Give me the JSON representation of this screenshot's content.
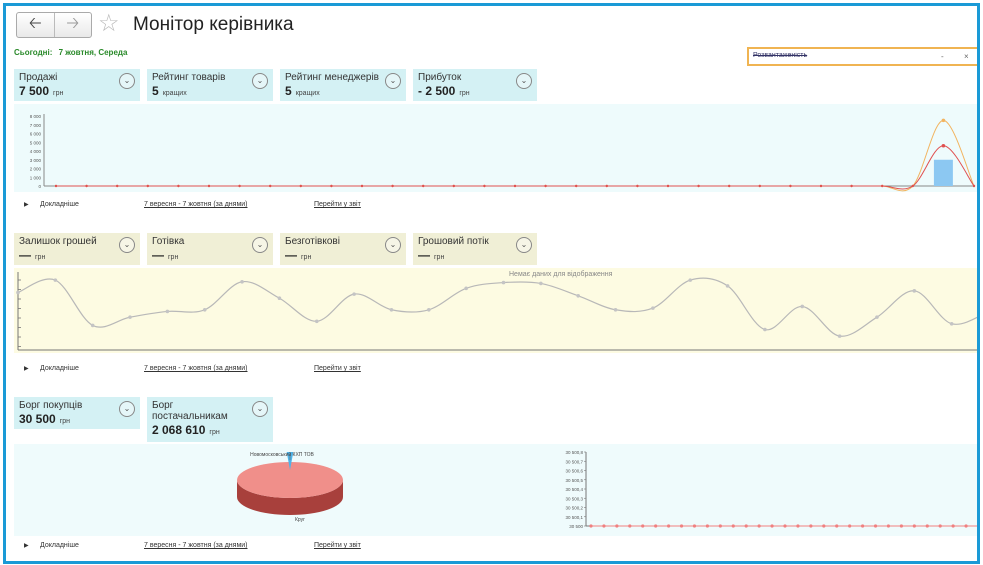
{
  "header": {
    "back_icon": "arrow-left-icon",
    "forward_icon": "arrow-right-icon",
    "favorite_icon": "star-icon",
    "title": "Монітор керівника",
    "today_label": "Сьогодні:",
    "today_date": "7 жовтня, Середа"
  },
  "search": {
    "value": "Розвантаженість",
    "minus_label": "-",
    "close_label": "×"
  },
  "sections": {
    "sales": {
      "cards": [
        {
          "label": "Продажі",
          "value": "7 500",
          "unit": "грн"
        },
        {
          "label": "Рейтинг товарів",
          "value": "5",
          "unit": "кращих"
        },
        {
          "label": "Рейтинг менеджерів",
          "value": "5",
          "unit": "кращих"
        },
        {
          "label": "Прибуток",
          "value": "- 2 500",
          "unit": "грн"
        }
      ],
      "footer": {
        "more": "Докладніше",
        "period": "7 вересня - 7 жовтня (за днями)",
        "goto": "Перейти у звіт"
      }
    },
    "money": {
      "cards": [
        {
          "label": "Залишок грошей",
          "value": "—",
          "unit": "грн"
        },
        {
          "label": "Готівка",
          "value": "—",
          "unit": "грн"
        },
        {
          "label": "Безготівкові",
          "value": "—",
          "unit": "грн"
        },
        {
          "label": "Грошовий потік",
          "value": "—",
          "unit": "грн"
        }
      ],
      "no_data": "Немає даних для відображення",
      "footer": {
        "more": "Докладніше",
        "period": "7 вересня - 7 жовтня (за днями)",
        "goto": "Перейти у звіт"
      }
    },
    "debts": {
      "cards": [
        {
          "label": "Борг покупців",
          "value": "30 500",
          "unit": "грн"
        },
        {
          "label": "Борг постачальникам",
          "value": "2 068 610",
          "unit": "грн"
        }
      ],
      "pie_label_top": "Новомосковський КХП ТОВ",
      "pie_label_bottom": "Круг",
      "footer": {
        "more": "Докладніше",
        "period": "7 вересня - 7 жовтня (за днями)",
        "goto": "Перейти у звіт"
      }
    }
  },
  "colors": {
    "accent": "#1a9ad6",
    "today_green": "#2a8a2a",
    "cyan_card": "#d4f1f4",
    "yellow_card": "#f0efd6",
    "pie_top": "#f08f8a",
    "pie_side": "#a8403c"
  },
  "chart_data": [
    {
      "type": "line",
      "title": "",
      "ylim": [
        0,
        8000
      ],
      "y_ticks": [
        "8 000",
        "7 000",
        "6 000",
        "5 000",
        "4 000",
        "3 000",
        "2 000",
        "1 000",
        "0"
      ],
      "points_count": 31,
      "peak_index": 29,
      "series": [
        {
          "name": "",
          "type": "bar",
          "peak_value": 3000
        },
        {
          "name": "",
          "type": "line",
          "color": "#e05050",
          "peak_value": 4600
        },
        {
          "name": "",
          "type": "line",
          "color": "#f2b460",
          "peak_value": 7500
        }
      ]
    },
    {
      "type": "line",
      "title": "",
      "points": 27,
      "values": [
        6.5,
        8,
        2.5,
        3.5,
        4.2,
        4.4,
        7.8,
        5.8,
        3.0,
        6.3,
        4.4,
        4.4,
        7.0,
        7.7,
        7.6,
        6.1,
        4.4,
        4.6,
        8.0,
        7.3,
        2.0,
        4.8,
        1.2,
        3.5,
        6.7,
        2.7,
        4.2
      ]
    },
    {
      "type": "pie",
      "title": "",
      "slices": [
        {
          "label": "Новомосковський КХП ТОВ",
          "value": 2
        },
        {
          "label": "Круг",
          "value": 98
        }
      ]
    },
    {
      "type": "line",
      "title": "",
      "y_ticks": [
        "30 500,8",
        "30 500,7",
        "30 500,6",
        "30 500,5",
        "30 500,4",
        "30 500,3",
        "30 500,2",
        "30 500,1",
        "30 500"
      ],
      "points_count": 31,
      "constant_value": 30500
    }
  ]
}
